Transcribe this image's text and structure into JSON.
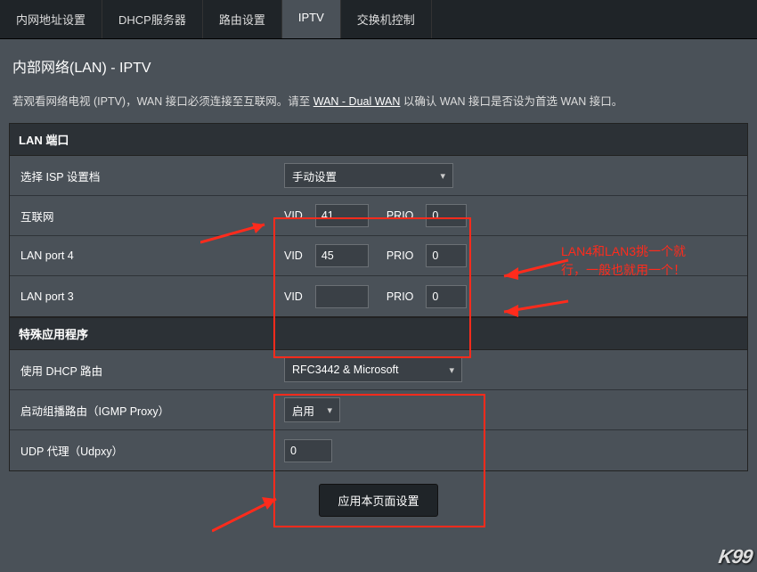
{
  "tabs": [
    {
      "label": "内网地址设置"
    },
    {
      "label": "DHCP服务器"
    },
    {
      "label": "路由设置"
    },
    {
      "label": "IPTV",
      "active": true
    },
    {
      "label": "交换机控制"
    }
  ],
  "page_title": "内部网络(LAN) - IPTV",
  "description_pre": "若观看网络电视 (IPTV)，WAN 接口必须连接至互联网。请至 ",
  "description_link": "WAN - Dual WAN",
  "description_post": " 以确认 WAN 接口是否设为首选 WAN 接口。",
  "section_lan_port": {
    "header": "LAN 端口",
    "rows": {
      "isp_profile": {
        "label": "选择 ISP 设置档",
        "select_value": "手动设置"
      },
      "internet": {
        "label": "互联网",
        "vid_label": "VID",
        "vid_value": "41",
        "prio_label": "PRIO",
        "prio_value": "0"
      },
      "lan4": {
        "label": "LAN port 4",
        "vid_label": "VID",
        "vid_value": "45",
        "prio_label": "PRIO",
        "prio_value": "0"
      },
      "lan3": {
        "label": "LAN port 3",
        "vid_label": "VID",
        "vid_value": "",
        "prio_label": "PRIO",
        "prio_value": "0"
      }
    }
  },
  "section_special": {
    "header": "特殊应用程序",
    "rows": {
      "dhcp_route": {
        "label": "使用 DHCP 路由",
        "select_value": "RFC3442 & Microsoft"
      },
      "igmp_proxy": {
        "label": "启动组播路由（IGMP Proxy）",
        "select_value": "启用"
      },
      "udpxy": {
        "label": "UDP 代理（Udpxy）",
        "value": "0"
      }
    }
  },
  "apply_button": "应用本页面设置",
  "annotation_text_line1": "LAN4和LAN3挑一个就",
  "annotation_text_line2": "行，一般也就用一个！",
  "logo": "K99"
}
